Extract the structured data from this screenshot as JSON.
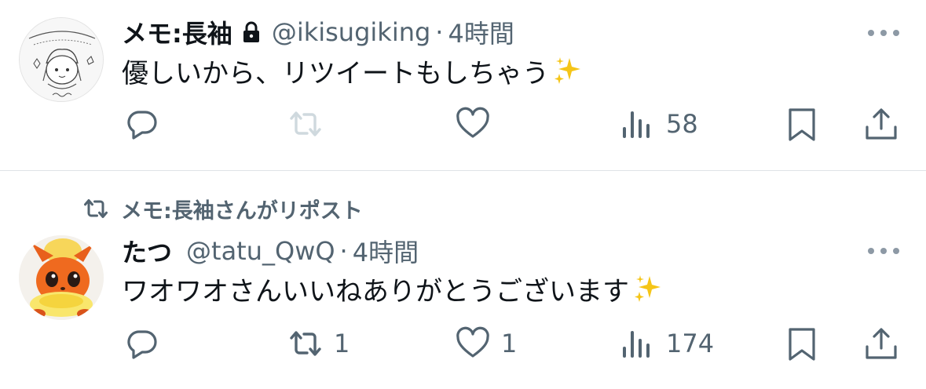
{
  "tweets": [
    {
      "name": "メモ:長袖",
      "handle": "@ikisugiking",
      "separator": "·",
      "time": "4時間",
      "text": "優しいから、リツイートもしちゃう",
      "emoji": "sparkles",
      "protected": true,
      "retweet_disabled": true,
      "views": "58"
    },
    {
      "reposted_by": "メモ:長袖さんがリポスト",
      "name": "たつ",
      "handle": "@tatu_QwQ",
      "separator": "·",
      "time": "4時間",
      "text": "ワオワオさんいいねありがとうございます",
      "emoji": "sparkles",
      "retweets": "1",
      "likes": "1",
      "views": "174"
    }
  ],
  "colors": {
    "text": "#0f1419",
    "secondary": "#536471",
    "disabled_icon": "#cfd9de",
    "divider": "#dfe3e6",
    "sparkle": "#f5c518"
  },
  "icons": [
    "reply-icon",
    "retweet-icon",
    "like-icon",
    "views-icon",
    "bookmark-icon",
    "share-icon",
    "lock-icon",
    "more-icon",
    "sparkles-icon"
  ]
}
